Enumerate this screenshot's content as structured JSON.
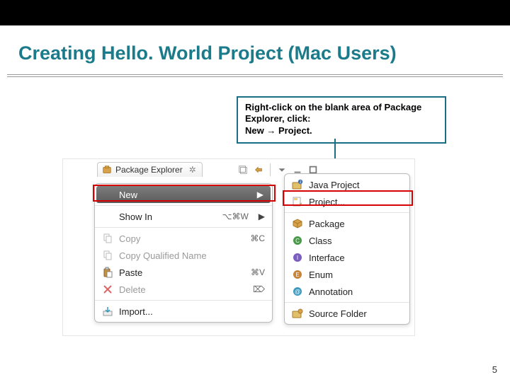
{
  "slide": {
    "title": "Creating Hello. World Project (Mac Users)",
    "page_number": "5"
  },
  "callout": {
    "line1": "Right-click on the blank area of Package",
    "line2": "Explorer, click:",
    "line3": "New → Project."
  },
  "package_explorer": {
    "tab_label": "Package Explorer",
    "tab_close_glyph": "✲"
  },
  "context_menu": {
    "new": {
      "label": "New",
      "has_submenu": true
    },
    "show_in": {
      "label": "Show In",
      "shortcut": "⌥⌘W",
      "has_submenu": true
    },
    "copy": {
      "label": "Copy",
      "shortcut": "⌘C"
    },
    "copy_qualified": {
      "label": "Copy Qualified Name"
    },
    "paste": {
      "label": "Paste",
      "shortcut": "⌘V"
    },
    "delete": {
      "label": "Delete",
      "shortcut": "⌦"
    },
    "import": {
      "label": "Import..."
    }
  },
  "submenu": {
    "java_project": "Java Project",
    "project": "Project...",
    "package": "Package",
    "class": "Class",
    "interface": "Interface",
    "enum": "Enum",
    "annotation": "Annotation",
    "source_folder": "Source Folder"
  }
}
